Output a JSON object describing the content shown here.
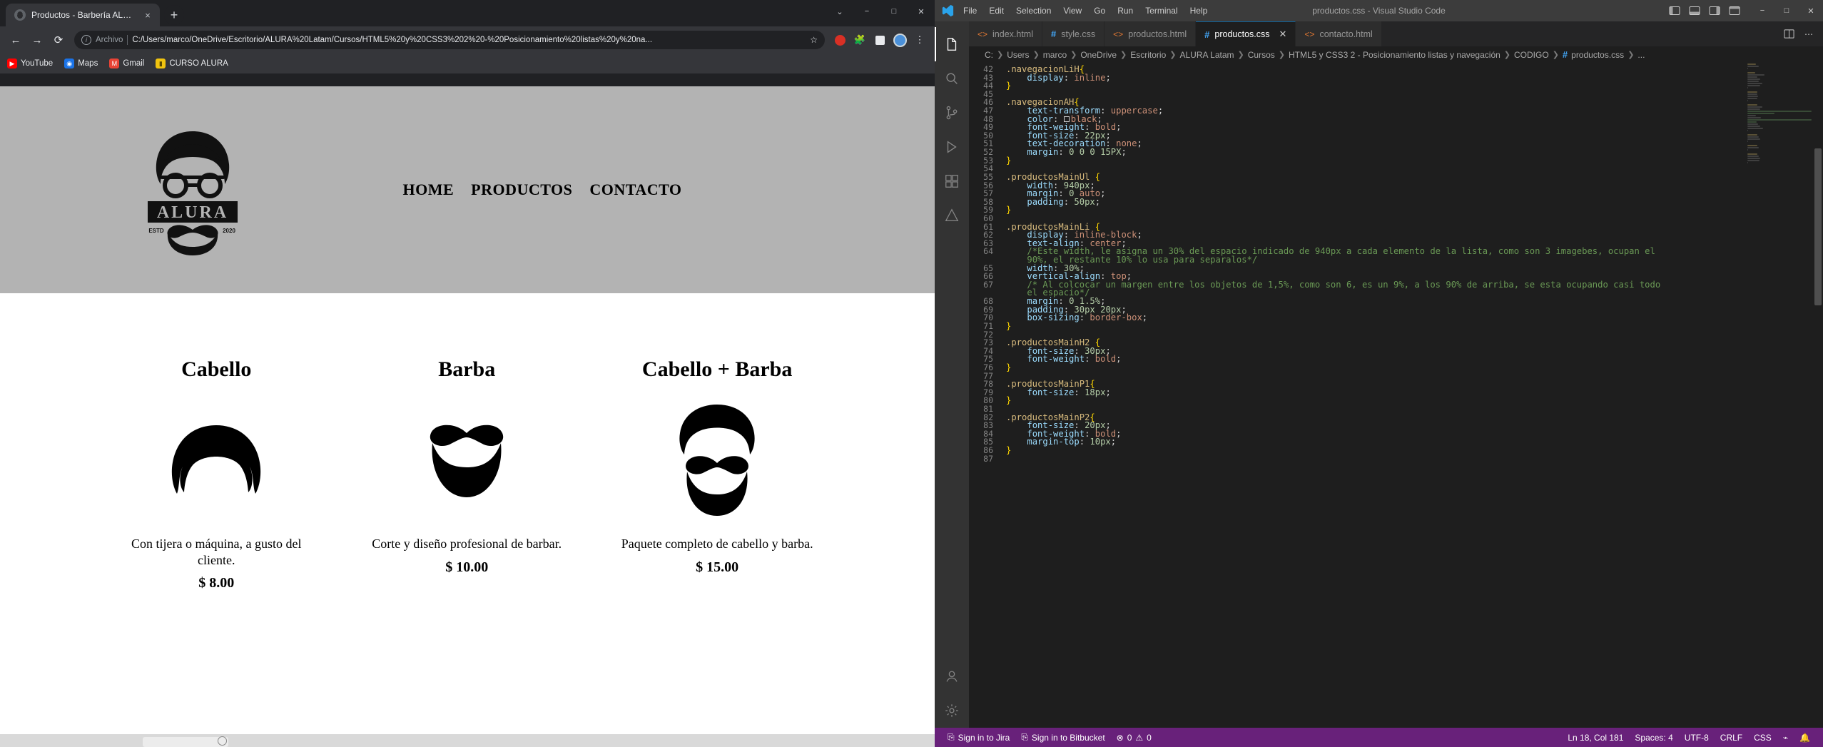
{
  "browser": {
    "tab": {
      "title": "Productos - Barbería ALURA",
      "favicon_icon": "globe-icon",
      "close_icon": "×"
    },
    "newtab_label": "+",
    "window_controls": {
      "more": "⌄",
      "minimize": "−",
      "maximize": "□",
      "close": "✕"
    },
    "nav": {
      "back": "←",
      "forward": "→",
      "reload": "⟳"
    },
    "omnibox": {
      "info_icon": "info-icon",
      "scheme_label": "Archivo",
      "url": "C:/Users/marco/OneDrive/Escritorio/ALURA%20Latam/Cursos/HTML5%20y%20CSS3%202%20-%20Posicionamiento%20listas%20y%20na...",
      "star_icon": "☆"
    },
    "toolbar_icons": [
      "extension-red-icon",
      "extension-puzzle-icon",
      "extension-square-icon",
      "profile-avatar",
      "menu-kebab-icon"
    ],
    "bookmarks": [
      {
        "label": "YouTube",
        "icon": "youtube-icon",
        "color": "#ff0000"
      },
      {
        "label": "Maps",
        "icon": "maps-icon",
        "color": "#1a73e8"
      },
      {
        "label": "Gmail",
        "icon": "gmail-icon",
        "color": "#ea4335"
      },
      {
        "label": "CURSO ALURA",
        "icon": "folder-icon",
        "color": "#f1c40f"
      }
    ],
    "page": {
      "logo": {
        "brand": "ALURA",
        "top_text": "ESTD",
        "bottom_text": "2020"
      },
      "nav_links": [
        "HOME",
        "PRODUCTOS",
        "CONTACTO"
      ],
      "products": [
        {
          "title": "Cabello",
          "image_icon": "hair-icon",
          "description": "Con tijera o máquina, a gusto del cliente.",
          "price": "$ 8.00"
        },
        {
          "title": "Barba",
          "image_icon": "beard-icon",
          "description": "Corte y diseño profesional de barbar.",
          "price": "$ 10.00"
        },
        {
          "title": "Cabello + Barba",
          "image_icon": "hair-beard-icon",
          "description": "Paquete completo de cabello y barba.",
          "price": "$ 15.00"
        }
      ]
    }
  },
  "vscode": {
    "window_title": "productos.css - Visual Studio Code",
    "menu": [
      "File",
      "Edit",
      "Selection",
      "View",
      "Go",
      "Run",
      "Terminal",
      "Help"
    ],
    "window_controls": {
      "minimize": "−",
      "maximize": "□",
      "close": "✕"
    },
    "tabs": [
      {
        "label": "index.html",
        "type": "html",
        "active": false
      },
      {
        "label": "style.css",
        "type": "css",
        "active": false
      },
      {
        "label": "productos.html",
        "type": "html",
        "active": false
      },
      {
        "label": "productos.css",
        "type": "css",
        "active": true
      },
      {
        "label": "contacto.html",
        "type": "html",
        "active": false
      }
    ],
    "breadcrumb": [
      "C:",
      "Users",
      "marco",
      "OneDrive",
      "Escritorio",
      "ALURA Latam",
      "Cursos",
      "HTML5 y CSS3 2 - Posicionamiento listas y navegación",
      "CODIGO",
      "productos.css",
      "..."
    ],
    "code_lines": [
      {
        "n": 42,
        "tokens": [
          [
            "sel",
            ".navegacionLiH"
          ],
          [
            "brace",
            "{"
          ]
        ]
      },
      {
        "n": 43,
        "tokens": [
          [
            "pun",
            "    "
          ],
          [
            "prop",
            "display"
          ],
          [
            "pun",
            ": "
          ],
          [
            "val",
            "inline"
          ],
          [
            "pun",
            ";"
          ]
        ]
      },
      {
        "n": 44,
        "tokens": [
          [
            "brace",
            "}"
          ]
        ]
      },
      {
        "n": 45,
        "tokens": []
      },
      {
        "n": 46,
        "tokens": [
          [
            "sel",
            ".navegacionAH"
          ],
          [
            "brace",
            "{"
          ]
        ]
      },
      {
        "n": 47,
        "tokens": [
          [
            "pun",
            "    "
          ],
          [
            "prop",
            "text-transform"
          ],
          [
            "pun",
            ": "
          ],
          [
            "val",
            "uppercase"
          ],
          [
            "pun",
            ";"
          ]
        ]
      },
      {
        "n": 48,
        "tokens": [
          [
            "pun",
            "    "
          ],
          [
            "prop",
            "color"
          ],
          [
            "pun",
            ": "
          ],
          [
            "swatch",
            ""
          ],
          [
            "val",
            "black"
          ],
          [
            "pun",
            ";"
          ]
        ]
      },
      {
        "n": 49,
        "tokens": [
          [
            "pun",
            "    "
          ],
          [
            "prop",
            "font-weight"
          ],
          [
            "pun",
            ": "
          ],
          [
            "val",
            "bold"
          ],
          [
            "pun",
            ";"
          ]
        ]
      },
      {
        "n": 50,
        "tokens": [
          [
            "pun",
            "    "
          ],
          [
            "prop",
            "font-size"
          ],
          [
            "pun",
            ": "
          ],
          [
            "num",
            "22px"
          ],
          [
            "pun",
            ";"
          ]
        ]
      },
      {
        "n": 51,
        "tokens": [
          [
            "pun",
            "    "
          ],
          [
            "prop",
            "text-decoration"
          ],
          [
            "pun",
            ": "
          ],
          [
            "val",
            "none"
          ],
          [
            "pun",
            ";"
          ]
        ]
      },
      {
        "n": 52,
        "tokens": [
          [
            "pun",
            "    "
          ],
          [
            "prop",
            "margin"
          ],
          [
            "pun",
            ": "
          ],
          [
            "num",
            "0 0 0 15PX"
          ],
          [
            "pun",
            ";"
          ]
        ]
      },
      {
        "n": 53,
        "tokens": [
          [
            "brace",
            "}"
          ]
        ]
      },
      {
        "n": 54,
        "tokens": []
      },
      {
        "n": 55,
        "tokens": [
          [
            "sel",
            ".productosMainUl"
          ],
          [
            "pun",
            " "
          ],
          [
            "brace",
            "{"
          ]
        ]
      },
      {
        "n": 56,
        "tokens": [
          [
            "pun",
            "    "
          ],
          [
            "prop",
            "width"
          ],
          [
            "pun",
            ": "
          ],
          [
            "num",
            "940px"
          ],
          [
            "pun",
            ";"
          ]
        ]
      },
      {
        "n": 57,
        "tokens": [
          [
            "pun",
            "    "
          ],
          [
            "prop",
            "margin"
          ],
          [
            "pun",
            ": "
          ],
          [
            "num",
            "0 "
          ],
          [
            "val",
            "auto"
          ],
          [
            "pun",
            ";"
          ]
        ]
      },
      {
        "n": 58,
        "tokens": [
          [
            "pun",
            "    "
          ],
          [
            "prop",
            "padding"
          ],
          [
            "pun",
            ": "
          ],
          [
            "num",
            "50px"
          ],
          [
            "pun",
            ";"
          ]
        ]
      },
      {
        "n": 59,
        "tokens": [
          [
            "brace",
            "}"
          ]
        ]
      },
      {
        "n": 60,
        "tokens": []
      },
      {
        "n": 61,
        "tokens": [
          [
            "sel",
            ".productosMainLi"
          ],
          [
            "pun",
            " "
          ],
          [
            "brace",
            "{"
          ]
        ]
      },
      {
        "n": 62,
        "tokens": [
          [
            "pun",
            "    "
          ],
          [
            "prop",
            "display"
          ],
          [
            "pun",
            ": "
          ],
          [
            "val",
            "inline-block"
          ],
          [
            "pun",
            ";"
          ]
        ]
      },
      {
        "n": 63,
        "tokens": [
          [
            "pun",
            "    "
          ],
          [
            "prop",
            "text-align"
          ],
          [
            "pun",
            ": "
          ],
          [
            "val",
            "center"
          ],
          [
            "pun",
            ";"
          ]
        ]
      },
      {
        "n": 64,
        "tokens": [
          [
            "pun",
            "    "
          ],
          [
            "cmt",
            "/*Este width, le asigna un 30% del espacio indicado de 940px a cada elemento de la lista, como son 3 imagebes, ocupan el"
          ]
        ]
      },
      {
        "n": "",
        "tokens": [
          [
            "pun",
            "    "
          ],
          [
            "cmt",
            "90%, el restante 10% lo usa para separalos*/"
          ]
        ]
      },
      {
        "n": 65,
        "tokens": [
          [
            "pun",
            "    "
          ],
          [
            "prop",
            "width"
          ],
          [
            "pun",
            ": "
          ],
          [
            "num",
            "30%"
          ],
          [
            "pun",
            ";"
          ]
        ]
      },
      {
        "n": 66,
        "tokens": [
          [
            "pun",
            "    "
          ],
          [
            "prop",
            "vertical-align"
          ],
          [
            "pun",
            ": "
          ],
          [
            "val",
            "top"
          ],
          [
            "pun",
            ";"
          ]
        ]
      },
      {
        "n": 67,
        "tokens": [
          [
            "pun",
            "    "
          ],
          [
            "cmt",
            "/* Al colcocar un margen entre los objetos de 1,5%, como son 6, es un 9%, a los 90% de arriba, se esta ocupando casi todo"
          ]
        ]
      },
      {
        "n": "",
        "tokens": [
          [
            "pun",
            "    "
          ],
          [
            "cmt",
            "el espacio*/"
          ]
        ]
      },
      {
        "n": 68,
        "tokens": [
          [
            "pun",
            "    "
          ],
          [
            "prop",
            "margin"
          ],
          [
            "pun",
            ": "
          ],
          [
            "num",
            "0 1.5%"
          ],
          [
            "pun",
            ";"
          ]
        ]
      },
      {
        "n": 69,
        "tokens": [
          [
            "pun",
            "    "
          ],
          [
            "prop",
            "padding"
          ],
          [
            "pun",
            ": "
          ],
          [
            "num",
            "30px 20px"
          ],
          [
            "pun",
            ";"
          ]
        ]
      },
      {
        "n": 70,
        "tokens": [
          [
            "pun",
            "    "
          ],
          [
            "prop",
            "box-sizing"
          ],
          [
            "pun",
            ": "
          ],
          [
            "val",
            "border-box"
          ],
          [
            "pun",
            ";"
          ]
        ]
      },
      {
        "n": 71,
        "tokens": [
          [
            "brace",
            "}"
          ]
        ]
      },
      {
        "n": 72,
        "tokens": []
      },
      {
        "n": 73,
        "tokens": [
          [
            "sel",
            ".productosMainH2"
          ],
          [
            "pun",
            " "
          ],
          [
            "brace",
            "{"
          ]
        ]
      },
      {
        "n": 74,
        "tokens": [
          [
            "pun",
            "    "
          ],
          [
            "prop",
            "font-size"
          ],
          [
            "pun",
            ": "
          ],
          [
            "num",
            "30px"
          ],
          [
            "pun",
            ";"
          ]
        ]
      },
      {
        "n": 75,
        "tokens": [
          [
            "pun",
            "    "
          ],
          [
            "prop",
            "font-weight"
          ],
          [
            "pun",
            ": "
          ],
          [
            "val",
            "bold"
          ],
          [
            "pun",
            ";"
          ]
        ]
      },
      {
        "n": 76,
        "tokens": [
          [
            "brace",
            "}"
          ]
        ]
      },
      {
        "n": 77,
        "tokens": []
      },
      {
        "n": 78,
        "tokens": [
          [
            "sel",
            ".productosMainP1"
          ],
          [
            "brace",
            "{"
          ]
        ]
      },
      {
        "n": 79,
        "tokens": [
          [
            "pun",
            "    "
          ],
          [
            "prop",
            "font-size"
          ],
          [
            "pun",
            ": "
          ],
          [
            "num",
            "18px"
          ],
          [
            "pun",
            ";"
          ]
        ]
      },
      {
        "n": 80,
        "tokens": [
          [
            "brace",
            "}"
          ]
        ]
      },
      {
        "n": 81,
        "tokens": []
      },
      {
        "n": 82,
        "tokens": [
          [
            "sel",
            ".productosMainP2"
          ],
          [
            "brace",
            "{"
          ]
        ]
      },
      {
        "n": 83,
        "tokens": [
          [
            "pun",
            "    "
          ],
          [
            "prop",
            "font-size"
          ],
          [
            "pun",
            ": "
          ],
          [
            "num",
            "20px"
          ],
          [
            "pun",
            ";"
          ]
        ]
      },
      {
        "n": 84,
        "tokens": [
          [
            "pun",
            "    "
          ],
          [
            "prop",
            "font-weight"
          ],
          [
            "pun",
            ": "
          ],
          [
            "val",
            "bold"
          ],
          [
            "pun",
            ";"
          ]
        ]
      },
      {
        "n": 85,
        "tokens": [
          [
            "pun",
            "    "
          ],
          [
            "prop",
            "margin-top"
          ],
          [
            "pun",
            ": "
          ],
          [
            "num",
            "10px"
          ],
          [
            "pun",
            ";"
          ]
        ]
      },
      {
        "n": 86,
        "tokens": [
          [
            "brace",
            "}"
          ]
        ]
      },
      {
        "n": 87,
        "tokens": []
      }
    ],
    "status_bar": {
      "jira": "Sign in to Jira",
      "bitbucket": "Sign in to Bitbucket",
      "errors": "0",
      "warnings": "0",
      "position": "Ln 18, Col 181",
      "spaces": "Spaces: 4",
      "encoding": "UTF-8",
      "eol": "CRLF",
      "language": "CSS",
      "bell_icon": "bell-icon",
      "feedback_icon": "feedback-icon"
    }
  }
}
